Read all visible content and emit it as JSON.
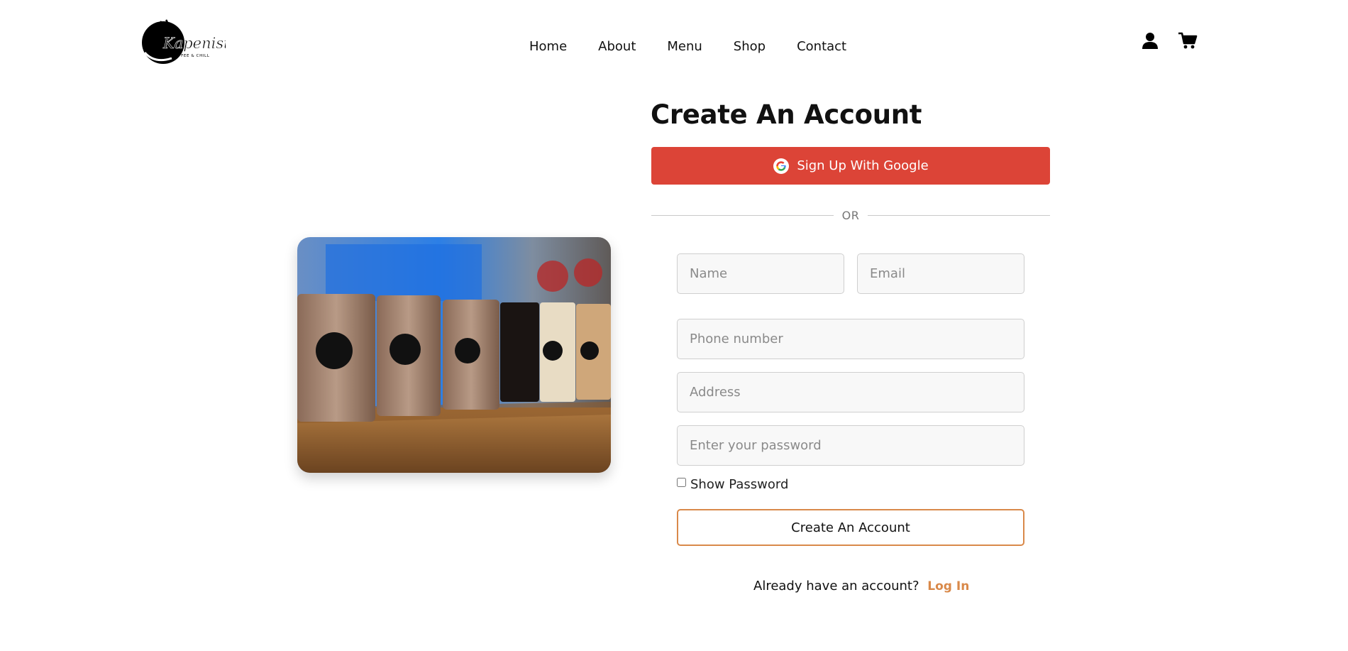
{
  "brand": {
    "logo_text": "Kapenista",
    "logo_subtext": "COFFEE & CHILL"
  },
  "nav": {
    "items": [
      {
        "label": "Home"
      },
      {
        "label": "About"
      },
      {
        "label": "Menu"
      },
      {
        "label": "Shop"
      },
      {
        "label": "Contact"
      }
    ]
  },
  "header_icons": {
    "account": "user-icon",
    "cart": "cart-icon"
  },
  "form": {
    "title": "Create An Account",
    "google_button_label": "Sign Up With Google",
    "divider_label": "OR",
    "name_placeholder": "Name",
    "email_placeholder": "Email",
    "phone_placeholder": "Phone number",
    "address_placeholder": "Address",
    "password_placeholder": "Enter your password",
    "show_password_label": "Show Password",
    "show_password_checked": false,
    "submit_label": "Create An Account",
    "login_prompt": "Already have an account?",
    "login_link_label": "Log In"
  },
  "colors": {
    "google_button": "#dc4437",
    "accent": "#d9894a"
  }
}
